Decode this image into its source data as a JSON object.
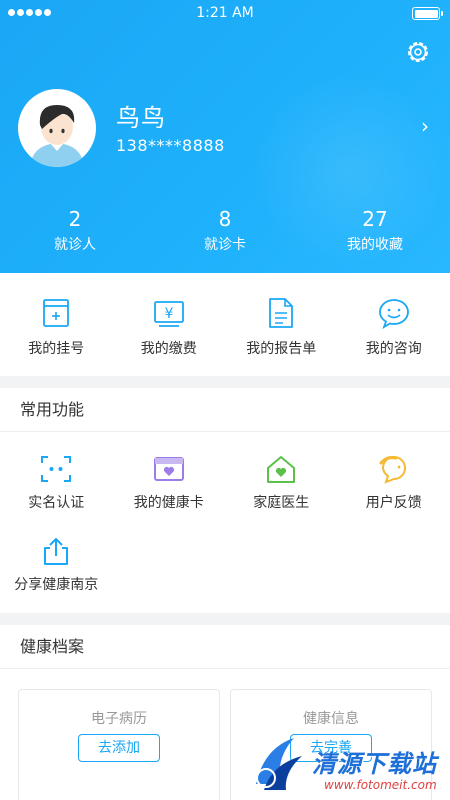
{
  "status_bar": {
    "time": "1:21 AM"
  },
  "profile": {
    "name": "鸟鸟",
    "phone": "138****8888"
  },
  "stats": [
    {
      "value": "2",
      "label": "就诊人"
    },
    {
      "value": "8",
      "label": "就诊卡"
    },
    {
      "value": "27",
      "label": "我的收藏"
    }
  ],
  "quick_actions": [
    {
      "label": "我的挂号",
      "icon": "registration-icon"
    },
    {
      "label": "我的缴费",
      "icon": "payment-icon"
    },
    {
      "label": "我的报告单",
      "icon": "report-icon"
    },
    {
      "label": "我的咨询",
      "icon": "consult-chat-icon"
    }
  ],
  "common_functions": {
    "title": "常用功能",
    "items": [
      {
        "label": "实名认证",
        "icon": "face-scan-icon"
      },
      {
        "label": "我的健康卡",
        "icon": "health-card-icon"
      },
      {
        "label": "家庭医生",
        "icon": "home-heart-icon"
      },
      {
        "label": "用户反馈",
        "icon": "feedback-icon"
      },
      {
        "label": "分享健康南京",
        "icon": "share-icon"
      }
    ]
  },
  "health_records": {
    "title": "健康档案",
    "cards": [
      {
        "title": "电子病历",
        "button": "去添加"
      },
      {
        "title": "健康信息",
        "button": "去完善"
      }
    ]
  },
  "watermark": {
    "text": "清源下载站",
    "url": "www.fotomeit.com"
  },
  "colors": {
    "primary": "#1aa7f5",
    "green": "#5cc04a",
    "purple": "#9b7ce8",
    "yellow": "#f5b932"
  }
}
